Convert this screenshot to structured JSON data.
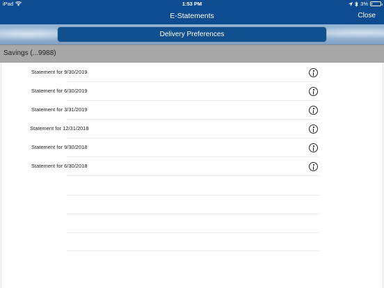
{
  "status_bar": {
    "device": "iPad",
    "time": "1:53 PM",
    "battery": "3%",
    "icons": [
      "wifi-icon",
      "location-arrow-icon",
      "bluetooth-icon",
      "battery-icon"
    ]
  },
  "nav": {
    "title": "E-Statements",
    "close_label": "Close"
  },
  "delivery_button": {
    "label": "Delivery Preferences"
  },
  "account": {
    "label": "Savings  (...9988)"
  },
  "statements": [
    {
      "label": "Statement for 9/30/2019"
    },
    {
      "label": "Statement for 6/30/2019"
    },
    {
      "label": "Statement for 3/31/2019"
    },
    {
      "label": "Statement for 12/31/2018"
    },
    {
      "label": "Statement for 9/30/2018"
    },
    {
      "label": "Statement for 6/30/2018"
    }
  ],
  "colors": {
    "nav_background": "#0d4c91",
    "button_background": "#11508f",
    "account_header": "#a8a8a8"
  }
}
